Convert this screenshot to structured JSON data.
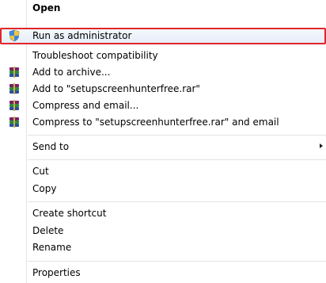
{
  "menu": {
    "items": [
      {
        "label": "Open"
      },
      {
        "label": "Run as administrator",
        "icon": "uac-shield-icon"
      },
      {
        "label": "Troubleshoot compatibility"
      },
      {
        "label": "Add to archive...",
        "icon": "winrar-icon"
      },
      {
        "label": "Add to \"setupscreenhunterfree.rar\"",
        "icon": "winrar-icon"
      },
      {
        "label": "Compress and email...",
        "icon": "winrar-icon"
      },
      {
        "label": "Compress to \"setupscreenhunterfree.rar\" and email",
        "icon": "winrar-icon"
      },
      {
        "label": "Send to"
      },
      {
        "label": "Cut"
      },
      {
        "label": "Copy"
      },
      {
        "label": "Create shortcut"
      },
      {
        "label": "Delete"
      },
      {
        "label": "Rename"
      },
      {
        "label": "Properties"
      }
    ]
  },
  "colors": {
    "highlight_border": "#e0262b",
    "separator": "#e2e3e3"
  }
}
